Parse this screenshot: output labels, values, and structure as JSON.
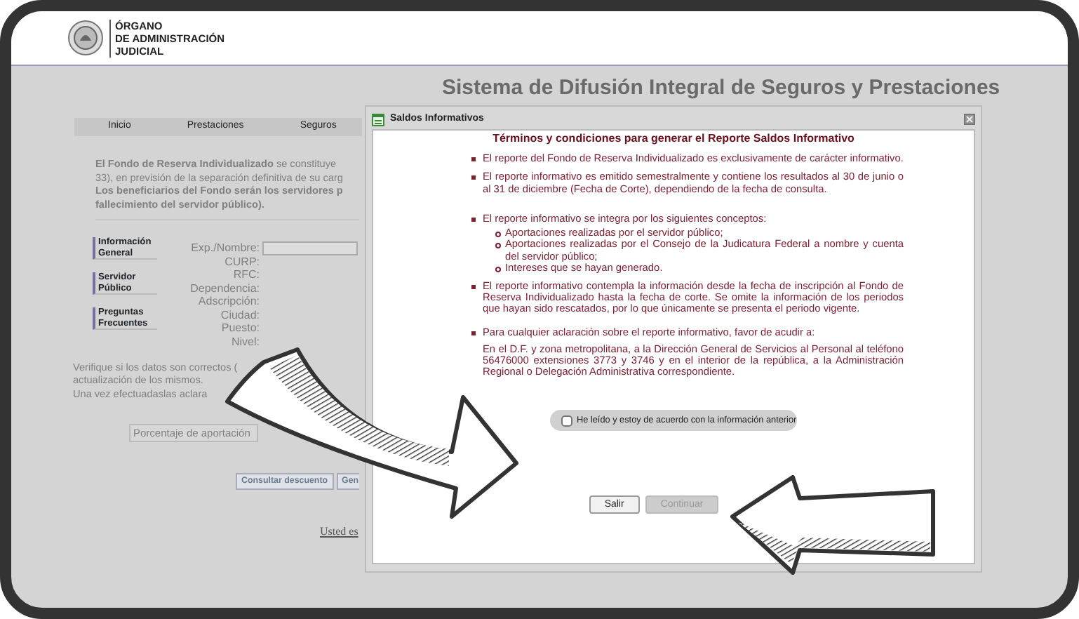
{
  "header": {
    "logo_lines": [
      "ÓRGANO",
      "DE ADMINISTRACIÓN",
      "JUDICIAL"
    ]
  },
  "page_title": "Sistema de Difusión Integral de Seguros y Prestaciones",
  "nav": [
    {
      "label": "Inicio"
    },
    {
      "label": "Prestaciones"
    },
    {
      "label": "Seguros"
    }
  ],
  "intro_lines": [
    {
      "text": "**El Fondo de Reserva Individualizado** se constituye",
      "bold": false
    },
    {
      "text": "33), en previsión de la separación definitiva de su carg",
      "bold": false
    },
    {
      "text": "Los beneficiarios del Fondo serán los servidores p",
      "bold": true
    },
    {
      "text": "fallecimiento del servidor público).",
      "bold": true
    }
  ],
  "sidebar_links": [
    {
      "label": "Información General"
    },
    {
      "label": "Servidor Público"
    },
    {
      "label": "Preguntas Frecuentes"
    }
  ],
  "form_fields": [
    {
      "label": "Exp./Nombre:",
      "kind": "input"
    },
    {
      "label": "CURP:",
      "kind": "text"
    },
    {
      "label": "RFC:",
      "kind": "text"
    },
    {
      "label": "Dependencia:",
      "kind": "text"
    },
    {
      "label": "Adscripción:",
      "kind": "text"
    },
    {
      "label": "Ciudad:",
      "kind": "text"
    },
    {
      "label": "Puesto:",
      "kind": "text"
    },
    {
      "label": "Nivel:",
      "kind": "text"
    }
  ],
  "notice_lines": [
    "Verifique si los datos son correctos (",
    "actualización de los mismos.",
    "Una vez efectuadaslas aclara"
  ],
  "percentage_field": {
    "placeholder": "Porcentaje de aportación"
  },
  "page_buttons": [
    {
      "label": "Consultar descuento"
    },
    {
      "label": "Gen"
    }
  ],
  "footer_link": "Usted es",
  "dialog": {
    "title": "Saldos Informativos",
    "heading": "Términos  y condiciones para generar el Reporte Saldos Informativo",
    "items": [
      {
        "text": "El reporte del Fondo de Reserva Individualizado es exclusivamente de carácter informativo."
      },
      {
        "text": "El reporte informativo es emitido semestralmente y contiene los resultados al 30 de junio o al 31 de diciembre (Fecha de Corte), dependiendo de la fecha de consulta."
      },
      {
        "text": "El reporte informativo se integra por los siguientes conceptos:",
        "children": [
          "Aportaciones realizadas por el servidor público;",
          "Aportaciones realizadas por el Consejo de la Judicatura Federal a nombre y cuenta del servidor público;",
          "Intereses que se hayan generado."
        ]
      },
      {
        "text": "El reporte informativo contempla la información desde la fecha de inscripción al Fondo de Reserva Individualizado hasta la fecha de corte. Se omite la información de los periodos que hayan sido rescatados, por lo que únicamente se presenta el periodo vigente."
      },
      {
        "text": "Para cualquier aclaración sobre el reporte informativo, favor de acudir a:",
        "note": "En el D.F. y zona metropolitana, a la Dirección General de Servicios al Personal al teléfono 56476000 extensiones 3773 y 3746 y en el interior de la república, a la Administración Regional o Delegación Administrativa correspondiente."
      }
    ],
    "agreement": {
      "label": "He leído y estoy de acuerdo con la información anterior",
      "checked": false
    },
    "buttons": [
      {
        "label": "Salir",
        "disabled": false
      },
      {
        "label": "Continuar",
        "disabled": true
      }
    ]
  },
  "annotations": [
    {
      "kind": "curved-arrow"
    },
    {
      "kind": "arrow"
    }
  ]
}
